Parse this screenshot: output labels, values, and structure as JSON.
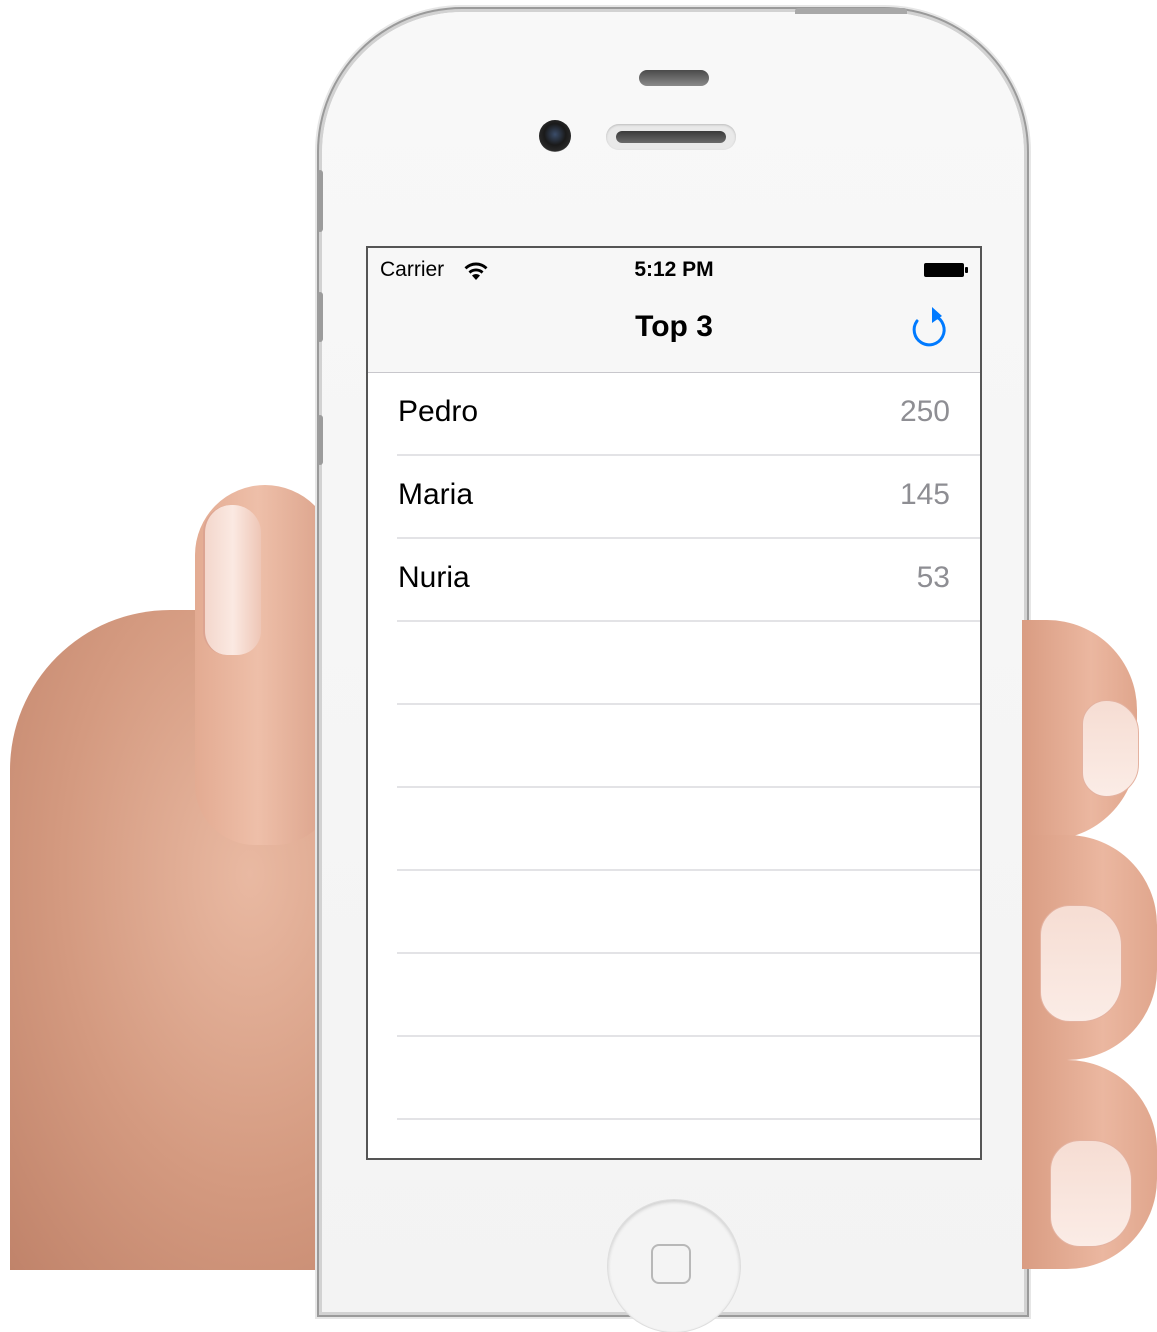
{
  "status_bar": {
    "carrier": "Carrier",
    "time": "5:12 PM",
    "wifi_icon": "wifi-icon",
    "battery_icon": "battery-icon"
  },
  "nav_bar": {
    "title": "Top 3",
    "refresh_icon": "refresh-icon",
    "accent_color": "#007aff"
  },
  "leaderboard": {
    "rows": [
      {
        "name": "Pedro",
        "score": "250"
      },
      {
        "name": "Maria",
        "score": "145"
      },
      {
        "name": "Nuria",
        "score": "53"
      }
    ],
    "empty_rows": 6
  }
}
